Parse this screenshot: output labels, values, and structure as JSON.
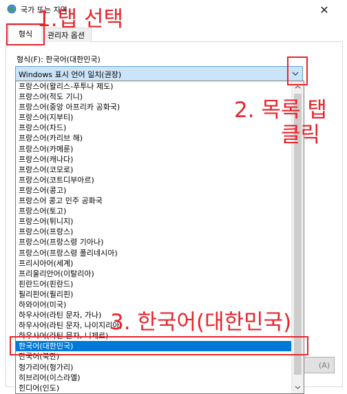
{
  "window": {
    "title": "국가 또는 지역",
    "close_glyph": "✕"
  },
  "tabs": [
    {
      "label": "형식",
      "active": true
    },
    {
      "label": "관리자 옵션",
      "active": false
    }
  ],
  "format_label": "형식(F): 한국어(대한민국)",
  "combo": {
    "value": "Windows 표시 언어 일치(권장)",
    "arrow_glyph": "⌄"
  },
  "list_items": [
    "프랑스어(왈리스-푸투나 제도)",
    "프랑스어(적도 기니)",
    "프랑스어(중앙 아프리카 공화국)",
    "프랑스어(지부티)",
    "프랑스어(차드)",
    "프랑스어(카리브 해)",
    "프랑스어(카메룬)",
    "프랑스어(캐나다)",
    "프랑스어(코모로)",
    "프랑스어(코트디부아르)",
    "프랑스어(콩고)",
    "프랑스어 콩고 민주 공화국",
    "프랑스어(토고)",
    "프랑스어(튀니지)",
    "프랑스어(프랑스)",
    "프랑스어(프랑스령 기아나)",
    "프랑스어(프랑스령 폴리네시아)",
    "프리시아어(세계)",
    "프리울리안어(이탈리아)",
    "핀란드어(핀란드)",
    "필리핀어(필리핀)",
    "하와이어(미국)",
    "하우사어(라틴 문자, 가나)",
    "하우사어(라틴 문자, 나이지리아)",
    "하우사어(라틴 문자, 니제르)",
    "한국어(대한민국)",
    "한국어(북한)",
    "헝가리어(헝가리)",
    "히브리어(이스라엘)",
    "힌디어(인도)"
  ],
  "selected_index": 25,
  "apply_button": {
    "label": "(A)"
  },
  "annotations": {
    "step1": "1.탭 선택",
    "step2_line1": "2. 목록 탭",
    "step2_line2": "클릭",
    "step3": "3. 한국어(대한민국)"
  },
  "colors": {
    "annotation_red": "#e8232b",
    "selection_blue": "#0078d7",
    "combo_bg": "#cce4f7"
  },
  "icons": {
    "app": "globe-icon",
    "close": "close-icon",
    "combo_arrow": "chevron-down-icon",
    "scroll_up": "scroll-up-arrow-icon",
    "scroll_down": "scroll-down-arrow-icon"
  }
}
